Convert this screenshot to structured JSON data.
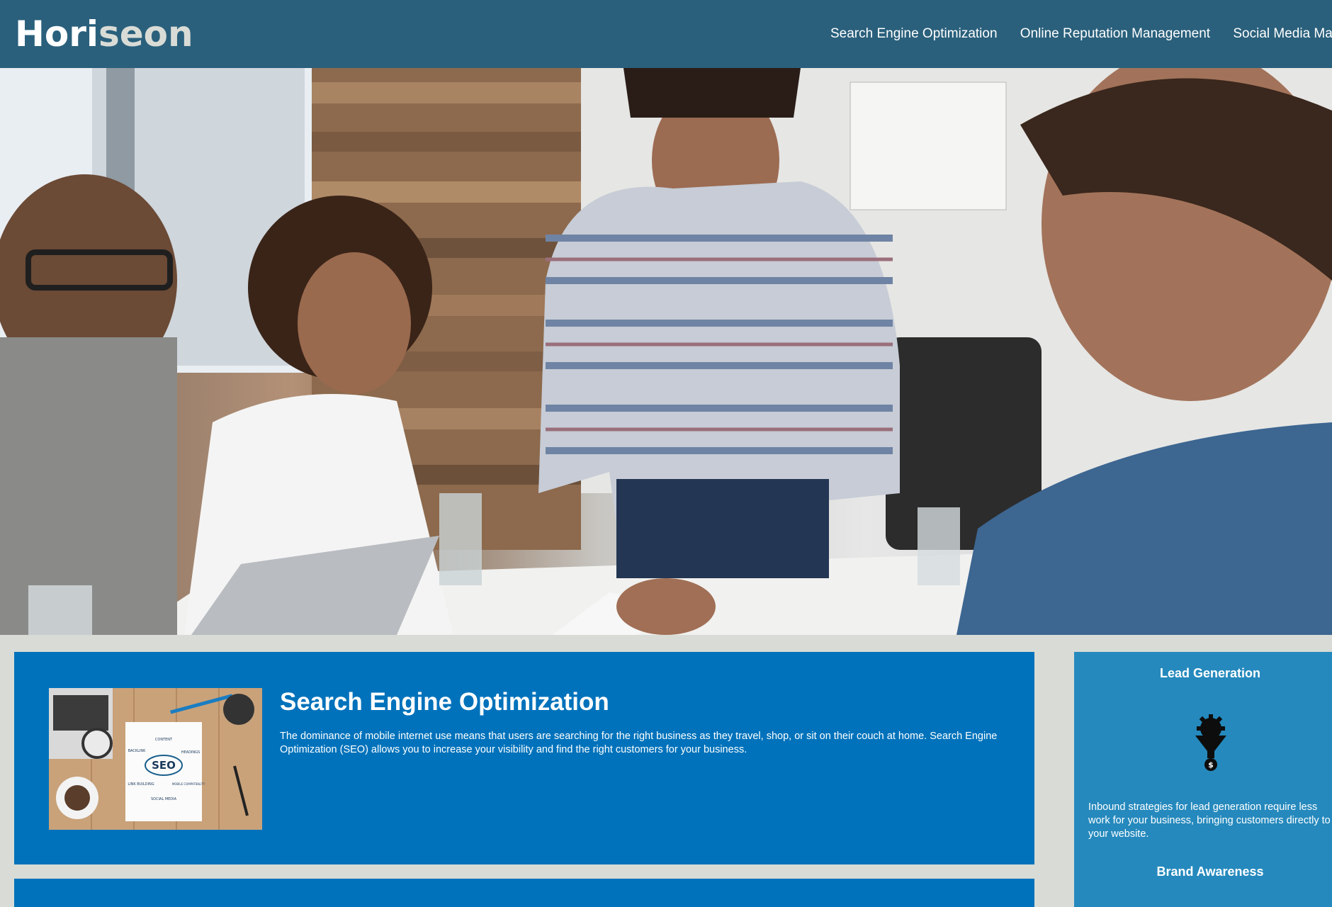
{
  "header": {
    "logo_part1": "Hori",
    "logo_part2": "seon",
    "nav": [
      {
        "label": "Search Engine Optimization"
      },
      {
        "label": "Online Reputation Management"
      },
      {
        "label": "Social Media Marketi"
      }
    ]
  },
  "hero": {
    "icon": "hero-photo"
  },
  "content": {
    "card": {
      "image_labels": {
        "center": "SEO",
        "content": "CONTENT",
        "backlink": "BACKLINK",
        "headings": "HEADINGS",
        "link_building": "LINK BUILDING",
        "mobile": "MOBILE COMPATIBILITY",
        "social": "SOCIAL MEDIA"
      },
      "title": "Search Engine Optimization",
      "text": "The dominance of mobile internet use means that users are searching for the right business as they travel, shop, or sit on their couch at home. Search Engine Optimization (SEO) allows you to increase your visibility and find the right customers for your business."
    }
  },
  "aside": {
    "lead_title": "Lead Generation",
    "lead_icon": "lead-generation-funnel-icon",
    "lead_text": "Inbound strategies for lead generation require less work for your business, bringing customers directly to your website.",
    "brand_title": "Brand Awareness"
  },
  "colors": {
    "header_bg": "#2a607c",
    "card_bg": "#0072bb",
    "aside_bg": "#2589bd",
    "page_bg": "#d9dcd6"
  }
}
